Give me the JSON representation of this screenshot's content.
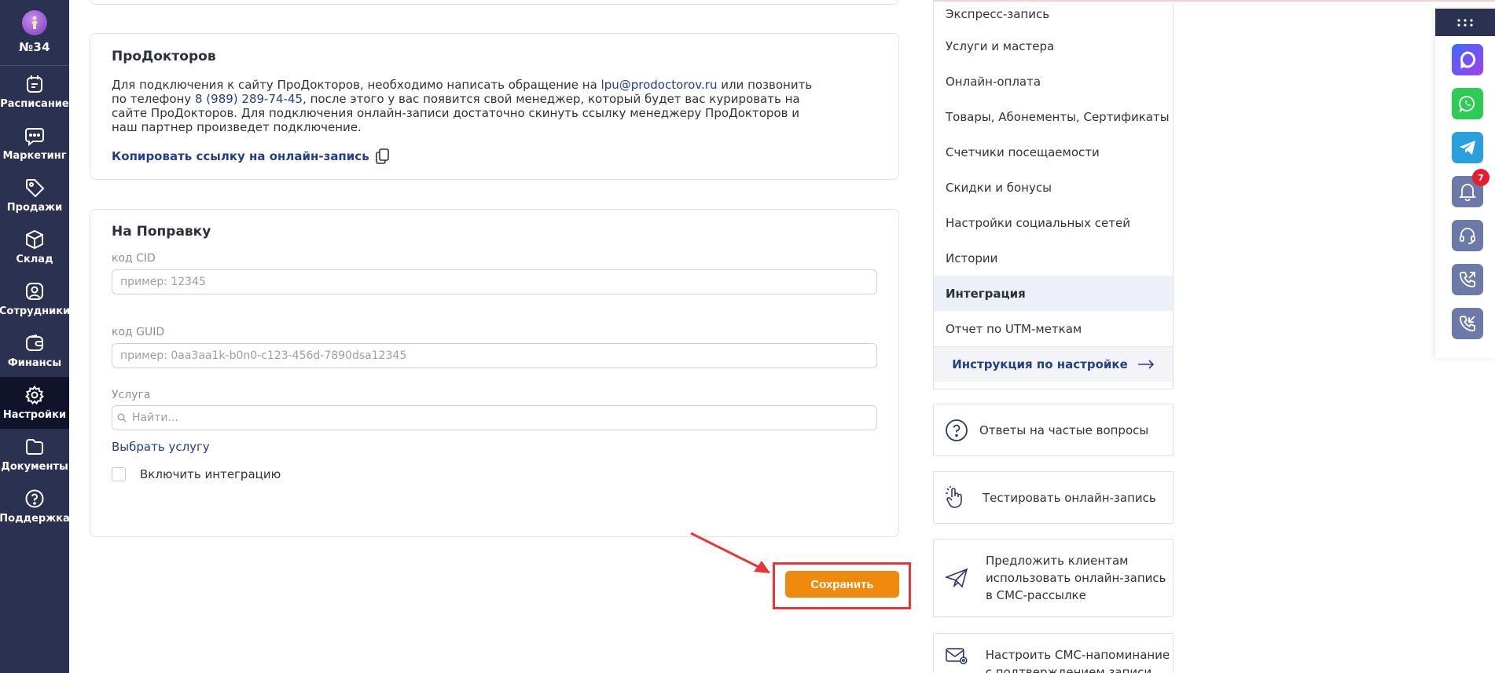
{
  "sidebar": {
    "logo_number": "№34",
    "items": [
      {
        "label": "Расписание",
        "icon": "calendar-icon"
      },
      {
        "label": "Маркетинг",
        "icon": "chat-icon"
      },
      {
        "label": "Продажи",
        "icon": "tag-icon"
      },
      {
        "label": "Склад",
        "icon": "box-icon"
      },
      {
        "label": "Сотрудники",
        "icon": "user-icon"
      },
      {
        "label": "Финансы",
        "icon": "wallet-icon"
      },
      {
        "label": "Настройки",
        "icon": "gear-icon"
      },
      {
        "label": "Документы",
        "icon": "folder-icon"
      },
      {
        "label": "Поддержка",
        "icon": "help-icon"
      }
    ],
    "active": "Настройки"
  },
  "prodoctorov": {
    "title": "ПроДокторов",
    "text_1": "Для подключения к сайту ПроДокторов, необходимо написать обращение на ",
    "email": "lpu@prodoctorov.ru",
    "text_2": " или позвонить по телефону ",
    "phone": "8 (989) 289-74-45",
    "text_3": ", после этого у вас появится свой менеджер, который будет вас курировать на сайте ПроДокторов. Для подключения онлайн-записи достаточно скинуть ссылку менеджеру ПроДокторов и наш партнер произведет подключение.",
    "copy_link": "Копировать ссылку на онлайн-запись"
  },
  "napopravku": {
    "title": "На Поправку",
    "cid_label": "код CID",
    "cid_placeholder": "пример: 12345",
    "guid_label": "код GUID",
    "guid_placeholder": "пример: 0aa3aa1k-b0n0-c123-456d-7890dsa12345",
    "service_label": "Услуга",
    "service_placeholder": "Найти...",
    "choose_service": "Выбрать услугу",
    "enable_integration": "Включить интеграцию"
  },
  "save_button": "Сохранить",
  "right_menu": {
    "items": [
      "Экспресс-запись",
      "Услуги и мастера",
      "Онлайн-оплата",
      "Товары, Абонементы, Сертификаты",
      "Счетчики посещаемости",
      "Скидки и бонусы",
      "Настройки социальных сетей",
      "Истории",
      "Интеграция",
      "Отчет по UTM-меткам"
    ],
    "active": "Интеграция",
    "instruction": "Инструкция по настройке"
  },
  "right_cards": {
    "faq": "Ответы на частые вопросы",
    "test": "Тестировать онлайн-запись",
    "offer": "Предложить клиентам использовать онлайн-запись в СМС-рассылке",
    "sms_reminder": "Настроить СМС-напоминание с подтверждением записи"
  },
  "strip": {
    "notification_count": "7"
  },
  "colors": {
    "sidebar_bg": "#2b3151",
    "accent_blue": "#22408a",
    "save_orange": "#ef8a0e",
    "highlight_red": "#e8353a"
  }
}
